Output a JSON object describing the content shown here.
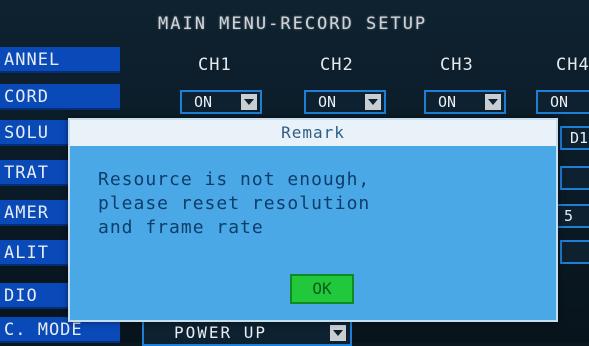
{
  "menu_title": "MAIN MENU-RECORD SETUP",
  "row_labels": [
    "ANNEL",
    "CORD",
    "SOLU",
    "TRAT",
    "AMER",
    "ALIT",
    "DIO",
    "C. MODE"
  ],
  "channels": [
    "CH1",
    "CH2",
    "CH3",
    "CH4"
  ],
  "record_values": [
    "ON",
    "ON",
    "ON",
    "ON"
  ],
  "partial_cells": {
    "resolution_right": "D1",
    "camera_right": "5"
  },
  "rec_mode_value": "POWER UP",
  "dialog": {
    "title": "Remark",
    "message_lines": [
      "Resource is not enough,",
      "please reset resolution",
      "and frame rate"
    ],
    "ok_label": "OK"
  },
  "colors": {
    "label_bg": "#0a49b8",
    "dialog_bg": "#4aa8e6",
    "ok_bg": "#22c83c"
  }
}
